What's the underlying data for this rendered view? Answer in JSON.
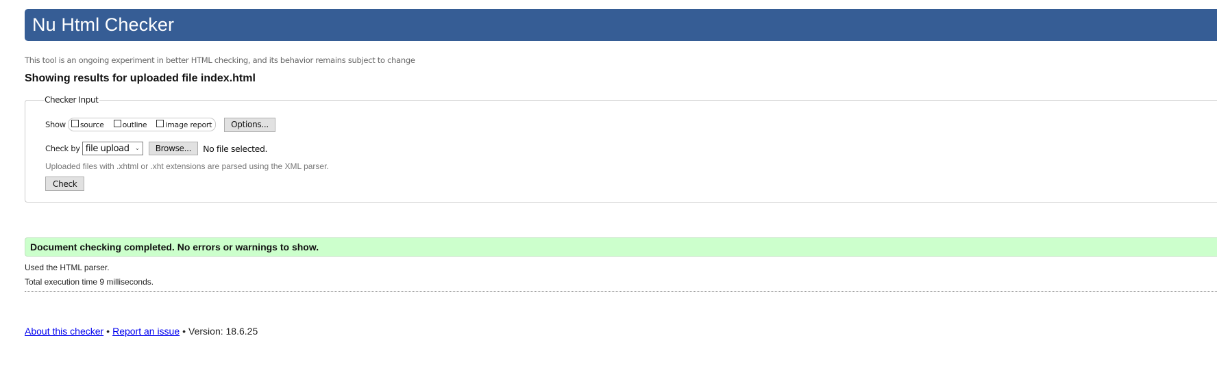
{
  "header": {
    "title": "Nu Html Checker"
  },
  "subtitle": "This tool is an ongoing experiment in better HTML checking, and its behavior remains subject to change",
  "results_heading": "Showing results for uploaded file index.html",
  "checker_input": {
    "legend": "Checker Input",
    "show_label": "Show",
    "show_options": [
      {
        "label": "source",
        "checked": false
      },
      {
        "label": "outline",
        "checked": false
      },
      {
        "label": "image report",
        "checked": false
      }
    ],
    "options_button": "Options...",
    "check_by_label": "Check by",
    "check_by_selected": "file upload",
    "browse_button": "Browse...",
    "file_status": "No file selected.",
    "hint": "Uploaded files with .xhtml or .xht extensions are parsed using the XML parser.",
    "check_button": "Check"
  },
  "result": {
    "message": "Document checking completed. No errors or warnings to show.",
    "color": "#ccffcc",
    "details": [
      "Used the HTML parser.",
      "Total execution time 9 milliseconds."
    ]
  },
  "footer": {
    "about_link": "About this checker",
    "separator": "•",
    "report_link": "Report an issue",
    "version": "Version: 18.6.25"
  },
  "colors": {
    "header_bg": "#365d95",
    "link": "#0000ee"
  }
}
